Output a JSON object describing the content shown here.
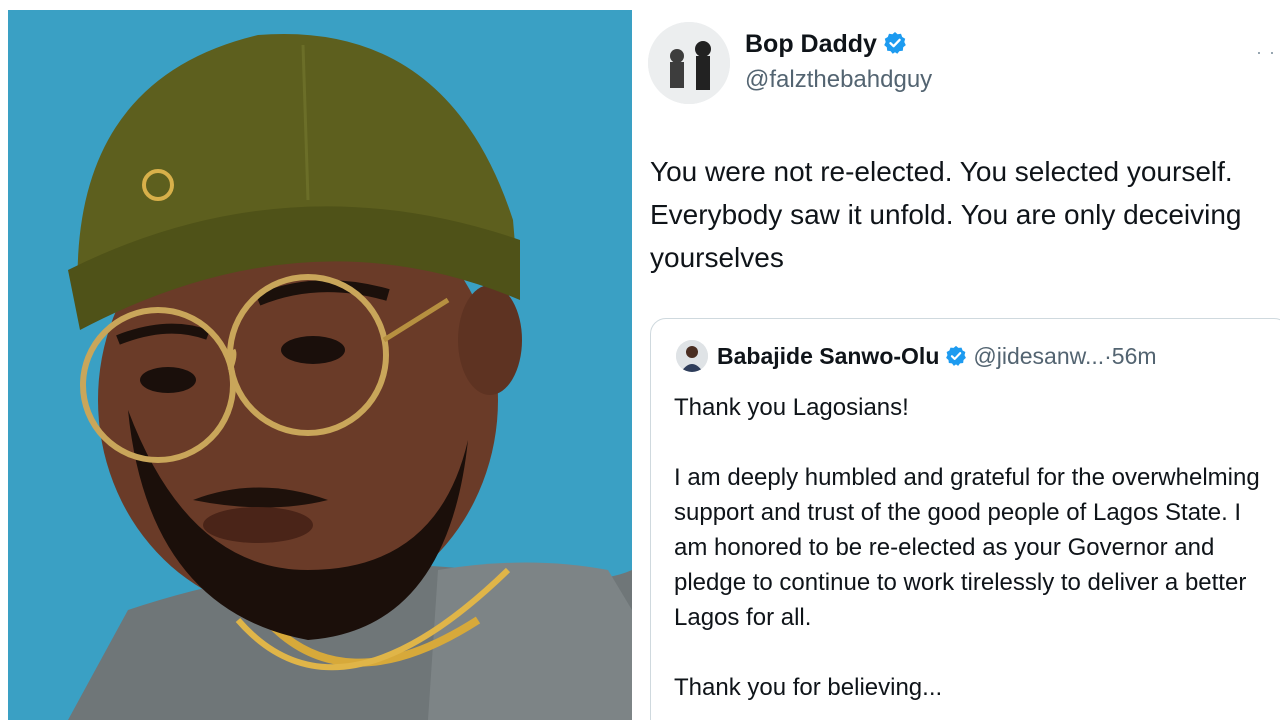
{
  "tweet": {
    "display_name": "Bop Daddy",
    "handle": "@falzthebahdguy",
    "text": "You were not re-elected. You selected yourself. Everybody saw it unfold. You are only deceiving yourselves",
    "more_menu": "· ·"
  },
  "quoted_tweet": {
    "display_name": "Babajide Sanwo-Olu",
    "handle": "@jidesanw...",
    "time": "·56m",
    "paragraphs": [
      "Thank you Lagosians!",
      "I am deeply humbled and grateful for the overwhelming support and trust of the good people of Lagos State. I am honored to be re-elected as your Governor and pledge to continue to work tirelessly to deliver a better Lagos for all.",
      "Thank you for believing..."
    ]
  },
  "colors": {
    "photo_background": "#3aa0c4",
    "verified_badge": "#1d9bf0",
    "secondary_text": "#536471",
    "primary_text": "#0f1419",
    "card_border": "#cfd9de"
  },
  "icons": {
    "verified": "verified-badge-icon",
    "more": "more-dots-icon"
  }
}
